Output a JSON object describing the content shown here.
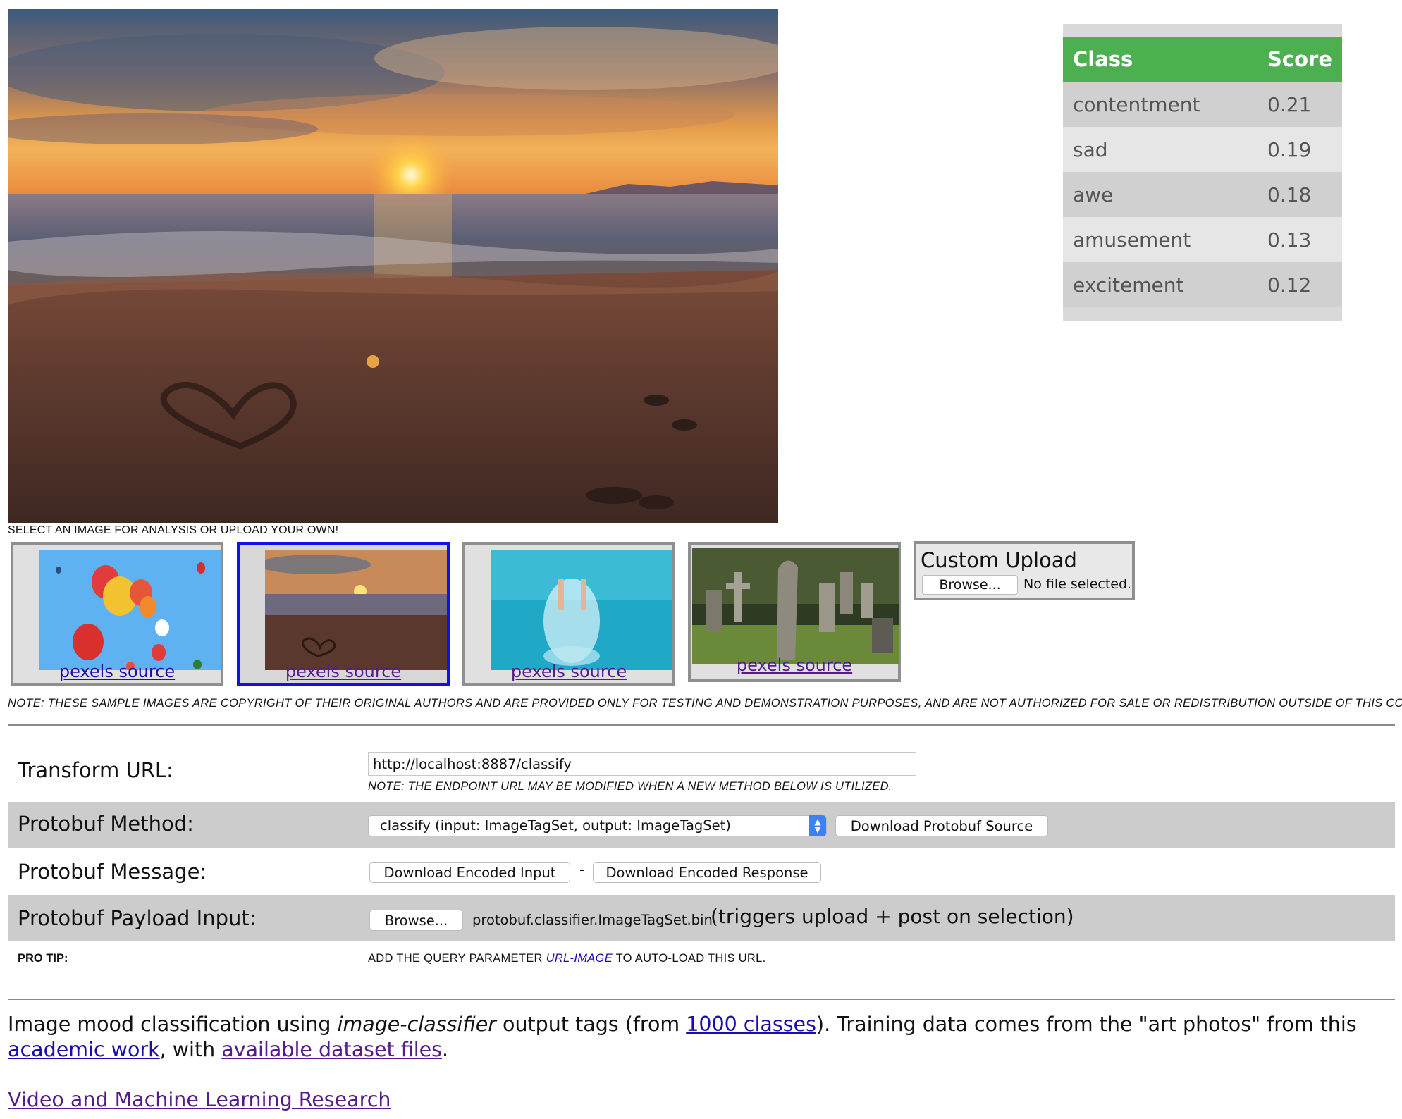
{
  "main_image": {
    "alt": "sunset beach with heart drawn in sand"
  },
  "scores": {
    "header_class": "Class",
    "header_score": "Score",
    "rows": [
      {
        "label": "contentment",
        "score": "0.21"
      },
      {
        "label": "sad",
        "score": "0.19"
      },
      {
        "label": "awe",
        "score": "0.18"
      },
      {
        "label": "amusement",
        "score": "0.13"
      },
      {
        "label": "excitement",
        "score": "0.12"
      }
    ]
  },
  "samples": {
    "caption": "SELECT AN IMAGE FOR ANALYSIS OR UPLOAD YOUR OWN!",
    "items": [
      {
        "link": "pexels source",
        "subject": "hot air balloons",
        "selected": false
      },
      {
        "link": "pexels source",
        "subject": "sunset beach",
        "selected": true
      },
      {
        "link": "pexels source",
        "subject": "swimmer splash",
        "selected": false
      },
      {
        "link": "pexels source",
        "subject": "old graveyard",
        "selected": false
      }
    ],
    "upload_title": "Custom Upload",
    "upload_browse": "Browse...",
    "upload_status": "No file selected.",
    "copyright_note": "NOTE: THESE SAMPLE IMAGES ARE COPYRIGHT OF THEIR ORIGINAL AUTHORS AND ARE PROVIDED ONLY FOR TESTING AND DEMONSTRATION PURPOSES, AND ARE NOT AUTHORIZED FOR SALE OR REDISTRIBUTION OUTSIDE OF THIS CONTEXT."
  },
  "form": {
    "transform_label": "Transform URL:",
    "transform_value": "http://localhost:8887/classify",
    "transform_note": "NOTE: THE ENDPOINT URL MAY BE MODIFIED WHEN A NEW METHOD BELOW IS UTILIZED.",
    "method_label": "Protobuf Method:",
    "method_selected": "classify (input: ImageTagSet, output: ImageTagSet)",
    "download_source": "Download Protobuf Source",
    "message_label": "Protobuf Message:",
    "download_input": "Download Encoded Input",
    "dash": "-",
    "download_response": "Download Encoded Response",
    "payload_label": "Protobuf Payload Input:",
    "payload_browse": "Browse...",
    "payload_file": "protobuf.classifier.ImageTagSet.bin",
    "payload_note": "(triggers upload + post on selection)",
    "protip_label": "PRO TIP:",
    "protip_before": "ADD THE QUERY PARAMETER ",
    "protip_link": "URL-IMAGE",
    "protip_after": " TO AUTO-LOAD THIS URL."
  },
  "footer": {
    "text1": "Image mood classification using ",
    "text2": "image-classifier",
    "text3": " output tags (from ",
    "link1": "1000 classes",
    "text4": "). Training data comes from the \"art photos\" from this ",
    "link2": "academic work",
    "text5": ", with ",
    "link3": "available dataset files",
    "text6": ".",
    "research_link": "Video and Machine Learning Research"
  }
}
